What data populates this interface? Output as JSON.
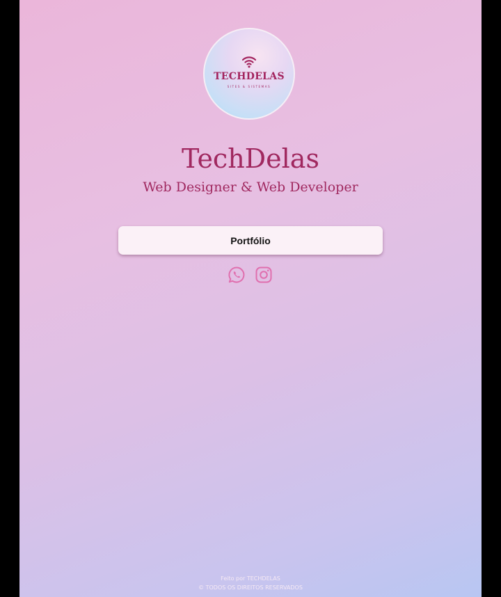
{
  "logo": {
    "title": "TECHDELAS",
    "subtitle": "SITES & SISTEMAS",
    "icon": "wifi-icon"
  },
  "profile": {
    "name": "TechDelas",
    "role": "Web Designer & Web Developer"
  },
  "links": {
    "portfolio_label": "Portfólio"
  },
  "social": [
    {
      "icon": "whatsapp-icon"
    },
    {
      "icon": "instagram-icon"
    }
  ],
  "footer": {
    "made_by": "Feito por TECHDELAS",
    "rights": "© TODOS OS DIREITOS RESERVADOS"
  },
  "colors": {
    "brand": "#a0285f",
    "icon_pink": "#e06fae",
    "button_bg": "#fbf1f7"
  }
}
